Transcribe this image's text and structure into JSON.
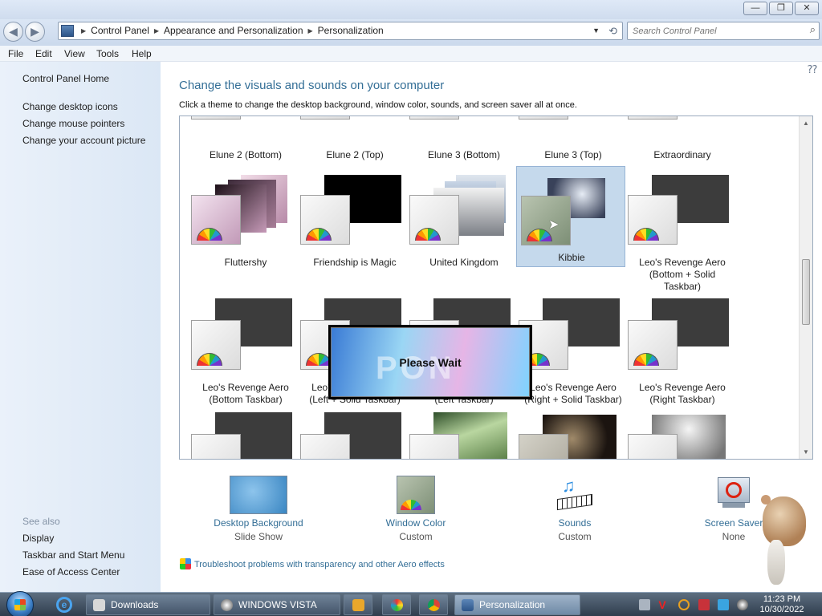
{
  "window": {
    "min_label": "—",
    "max_label": "❐",
    "close_label": "✕"
  },
  "nav": {
    "back": "◀",
    "forward": "▶",
    "breadcrumbs": [
      "Control Panel",
      "Appearance and Personalization",
      "Personalization"
    ],
    "dropdown": "▼",
    "refresh": "⟲"
  },
  "search": {
    "placeholder": "Search Control Panel",
    "icon": "search-icon"
  },
  "menu": [
    "File",
    "Edit",
    "View",
    "Tools",
    "Help"
  ],
  "sidebar": {
    "home": "Control Panel Home",
    "links": [
      "Change desktop icons",
      "Change mouse pointers",
      "Change your account picture"
    ],
    "see_also_label": "See also",
    "see_also": [
      "Display",
      "Taskbar and Start Menu",
      "Ease of Access Center"
    ]
  },
  "main": {
    "heading": "Change the visuals and sounds on your computer",
    "subtext": "Click a theme to change the desktop background, window color, sounds, and screen saver all at once."
  },
  "themes": [
    [
      "Elune 2 (Bottom)",
      "Elune 2 (Top)",
      "Elune 3 (Bottom)",
      "Elune 3 (Top)",
      "Extraordinary"
    ],
    [
      "Fluttershy",
      "Friendship is Magic",
      "United Kingdom",
      "Kibbie",
      "Leo's Revenge Aero\n(Bottom + Solid\nTaskbar)"
    ],
    [
      "Leo's Revenge Aero\n(Bottom Taskbar)",
      "Leo's Revenge Aero\n(Left + Solid Taskbar)",
      "Leo's Revenge Aero\n(Left Taskbar)",
      "Leo's Revenge Aero\n(Right + Solid Taskbar)",
      "Leo's Revenge Aero\n(Right Taskbar)"
    ]
  ],
  "selected_theme": "Kibbie",
  "please_wait": {
    "text": "Please Wait",
    "logo": "PON"
  },
  "bottom": [
    {
      "title": "Desktop Background",
      "value": "Slide Show"
    },
    {
      "title": "Window Color",
      "value": "Custom"
    },
    {
      "title": "Sounds",
      "value": "Custom"
    },
    {
      "title": "Screen Saver",
      "value": "None"
    }
  ],
  "troubleshoot": "Troubleshoot problems with transparency and other Aero effects",
  "taskbar": {
    "buttons": [
      "Downloads",
      "WINDOWS VISTA",
      "Personalization"
    ],
    "clock_time": "11:23 PM",
    "clock_date": "10/30/2022"
  },
  "colors": {
    "accent": "#336e96",
    "selection": "#c5d9ec"
  }
}
